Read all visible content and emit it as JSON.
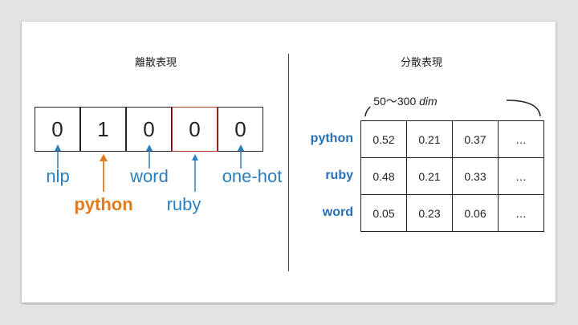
{
  "left": {
    "title": "離散表現",
    "vector": [
      {
        "value": "0",
        "highlight": false
      },
      {
        "value": "1",
        "highlight": false
      },
      {
        "value": "0",
        "highlight": false
      },
      {
        "value": "0",
        "highlight": true
      },
      {
        "value": "0",
        "highlight": false
      }
    ],
    "words": {
      "nlp": "nlp",
      "python": "python",
      "word": "word",
      "ruby": "ruby",
      "onehot": "one-hot"
    }
  },
  "right": {
    "title": "分散表現",
    "dim_prefix": "50〜300 ",
    "dim_italic": "dim",
    "rows": [
      {
        "label": "python",
        "values": [
          "0.52",
          "0.21",
          "0.37",
          "…"
        ]
      },
      {
        "label": "ruby",
        "values": [
          "0.48",
          "0.21",
          "0.33",
          "…"
        ]
      },
      {
        "label": "word",
        "values": [
          "0.05",
          "0.23",
          "0.06",
          "…"
        ]
      }
    ]
  },
  "colors": {
    "blue": "#2a7fc0",
    "orange": "#e07b1f",
    "highlight_border": "#b03a2e",
    "row_label": "#2670b8"
  }
}
